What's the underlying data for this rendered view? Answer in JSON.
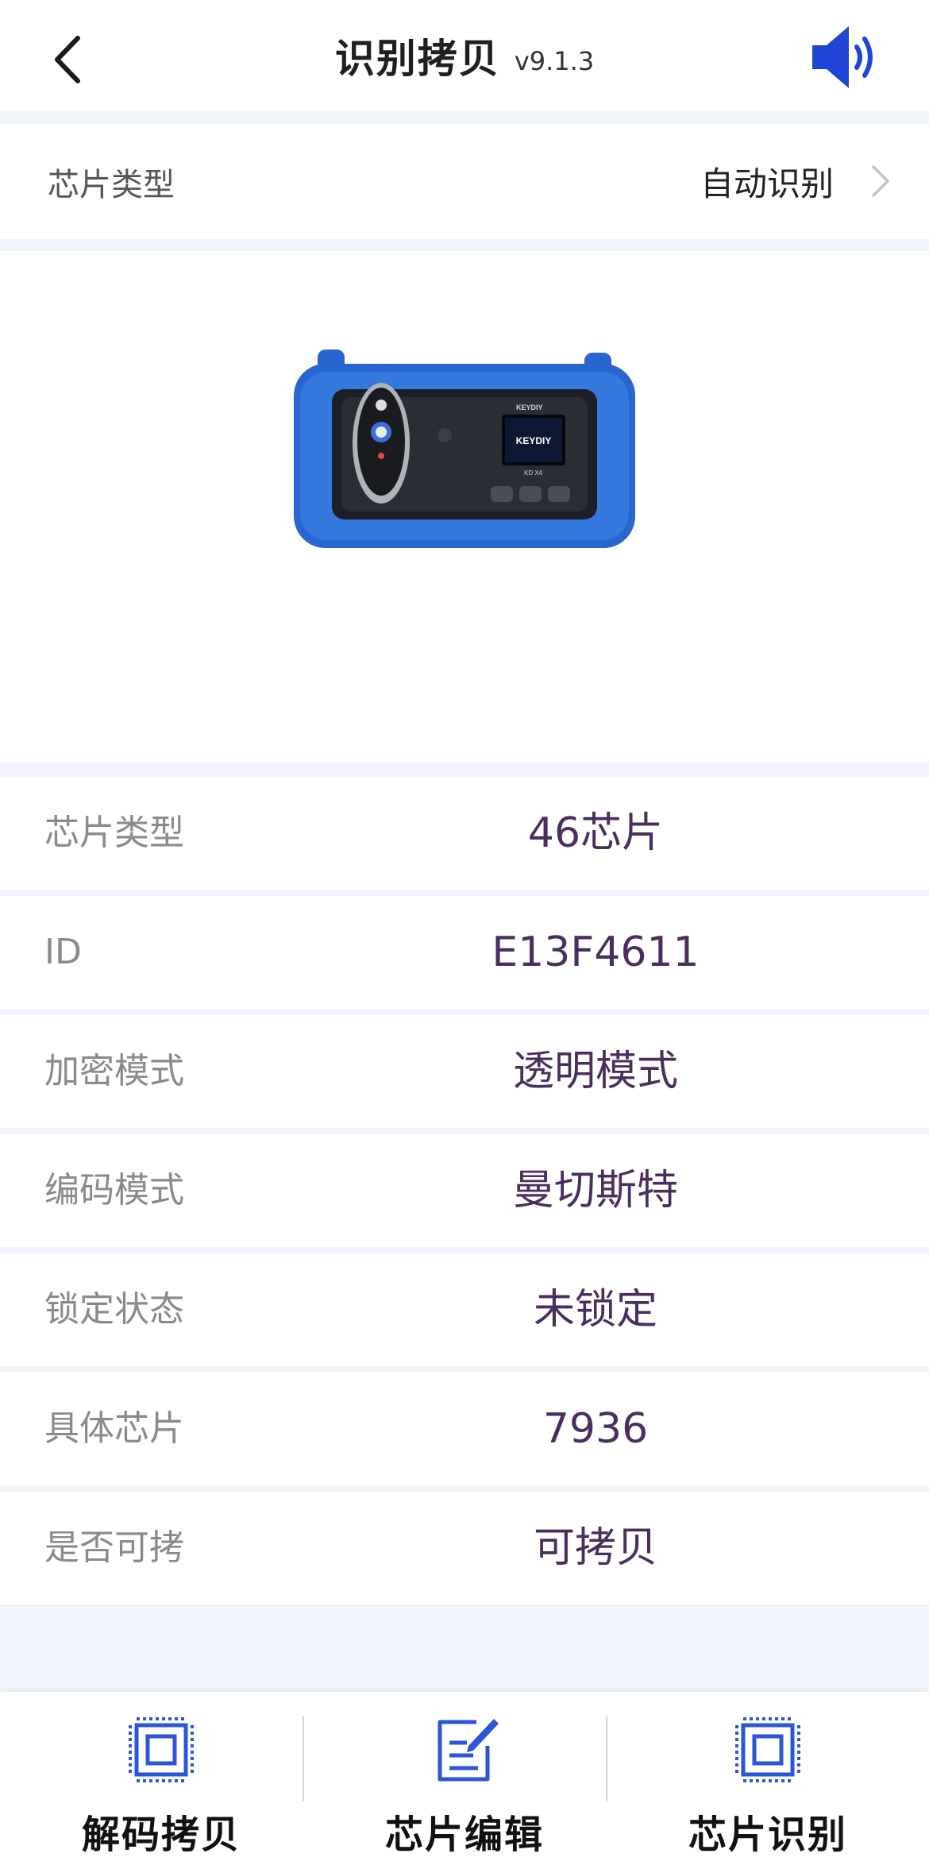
{
  "header": {
    "title": "识别拷贝",
    "version": "v9.1.3"
  },
  "chip_select": {
    "label": "芯片类型",
    "value": "自动识别"
  },
  "device_image": {
    "brand": "KEYDIY",
    "model": "KD X4"
  },
  "info_rows": [
    {
      "label": "芯片类型",
      "value": "46芯片"
    },
    {
      "label": "ID",
      "value": "E13F4611"
    },
    {
      "label": "加密模式",
      "value": "透明模式"
    },
    {
      "label": "编码模式",
      "value": "曼切斯特"
    },
    {
      "label": "锁定状态",
      "value": "未锁定"
    },
    {
      "label": "具体芯片",
      "value": "7936"
    },
    {
      "label": "是否可拷",
      "value": "可拷贝"
    }
  ],
  "bottom_nav": [
    {
      "label": "解码拷贝",
      "icon": "chip-icon"
    },
    {
      "label": "芯片编辑",
      "icon": "edit-icon"
    },
    {
      "label": "芯片识别",
      "icon": "chip-scan-icon"
    }
  ],
  "colors": {
    "accent": "#2b56d8",
    "value_text": "#4a2f5e",
    "device_blue": "#2f6fd6"
  }
}
